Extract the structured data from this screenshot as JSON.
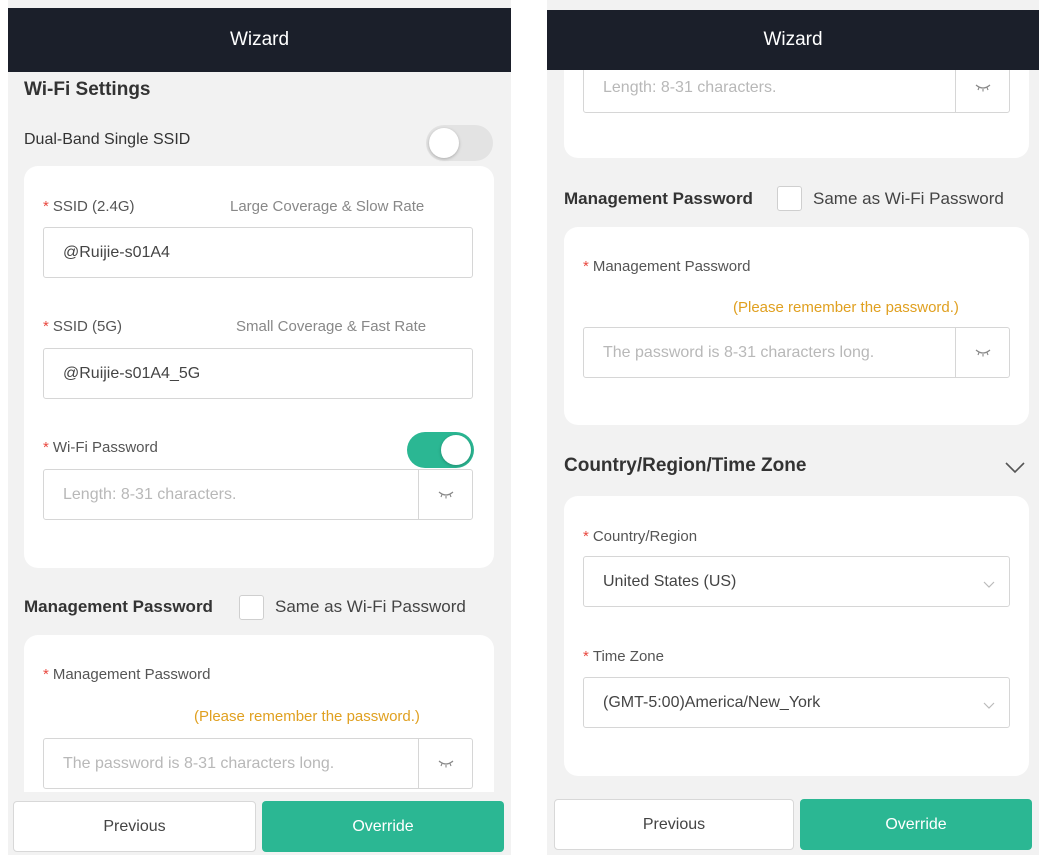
{
  "colors": {
    "header_bg": "#1b1f2a",
    "accent": "#2bb793",
    "required": "#e9483f",
    "warning": "#e0a020"
  },
  "left_screen": {
    "header_title": "Wizard",
    "wifi_settings_title": "Wi-Fi Settings",
    "dual_band": {
      "label": "Dual-Band Single SSID",
      "enabled": false
    },
    "ssid_24": {
      "required_mark": "*",
      "label": "SSID (2.4G)",
      "hint": "Large Coverage & Slow Rate",
      "value": "@Ruijie-s01A4"
    },
    "ssid_5": {
      "required_mark": "*",
      "label": "SSID (5G)",
      "hint": "Small Coverage & Fast Rate",
      "value": "@Ruijie-s01A4_5G"
    },
    "wifi_password": {
      "required_mark": "*",
      "label": "Wi-Fi Password",
      "enabled": true,
      "placeholder": "Length: 8-31 characters."
    },
    "management": {
      "title": "Management Password",
      "same_label": "Same as Wi-Fi Password",
      "required_mark": "*",
      "field_label": "Management Password",
      "remember_note": "(Please remember the password.)",
      "placeholder": "The password is 8-31 characters long."
    },
    "buttons": {
      "previous": "Previous",
      "override": "Override"
    }
  },
  "right_screen": {
    "header_title": "Wizard",
    "wifi_password_placeholder": "Length: 8-31 characters.",
    "management": {
      "title": "Management Password",
      "same_label": "Same as Wi-Fi Password",
      "required_mark": "*",
      "field_label": "Management Password",
      "remember_note": "(Please remember the password.)",
      "placeholder": "The password is 8-31 characters long."
    },
    "region_section_title": "Country/Region/Time Zone",
    "country": {
      "required_mark": "*",
      "label": "Country/Region",
      "value": "United States (US)"
    },
    "timezone": {
      "required_mark": "*",
      "label": "Time Zone",
      "value": "(GMT-5:00)America/New_York"
    },
    "buttons": {
      "previous": "Previous",
      "override": "Override"
    }
  },
  "icons": {
    "password_toggle": "eye-closed-icon",
    "select_arrow": "chevron-down-icon",
    "collapse": "chevron-down-icon"
  }
}
